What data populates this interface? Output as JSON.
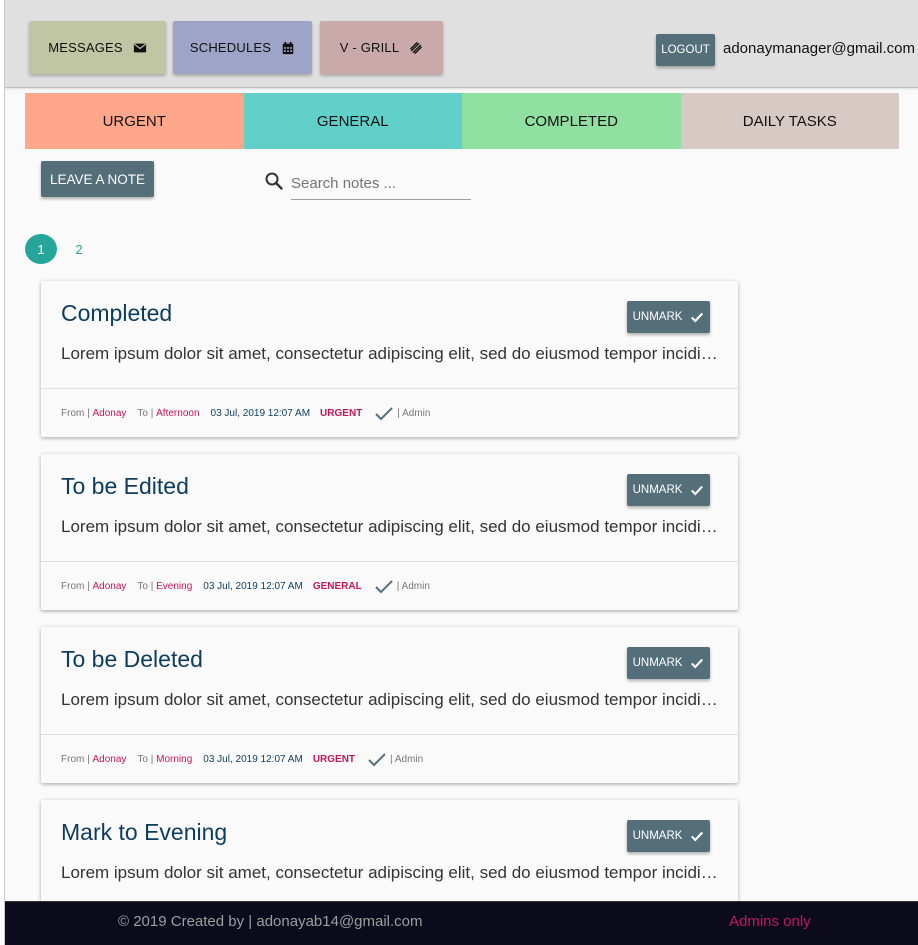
{
  "header": {
    "nav": [
      {
        "label": "MESSAGES",
        "icon": "envelope-icon",
        "color": "#c0c5a3"
      },
      {
        "label": "SCHEDULES",
        "icon": "calendar-icon",
        "color": "#9ea4c7"
      },
      {
        "label": "V - GRILL",
        "icon": "link-icon",
        "color": "#c9a9a9"
      }
    ],
    "logout_label": "LOGOUT",
    "user_email": "adonaymanager@gmail.com"
  },
  "tabs": [
    {
      "label": "URGENT",
      "color": "#ffa78a"
    },
    {
      "label": "GENERAL",
      "color": "#61d0c8"
    },
    {
      "label": "COMPLETED",
      "color": "#90e0a2"
    },
    {
      "label": "DAILY TASKS",
      "color": "#d7cac5"
    }
  ],
  "toolbar": {
    "leave_note_label": "LEAVE A NOTE",
    "search_placeholder": "Search notes ..."
  },
  "pagination": {
    "pages": [
      "1",
      "2"
    ],
    "current": "1"
  },
  "notes": [
    {
      "title": "Completed",
      "body": "Lorem ipsum dolor sit amet, consectetur adipiscing elit, sed do eiusmod tempor incididunt ut labore et dolore magna aliqua.",
      "button": "UNMARK",
      "from_label": "From |",
      "from": "Adonay",
      "to_label": "To |",
      "to": "Afternoon",
      "time": "03 Jul, 2019 12:07 AM",
      "category": "URGENT",
      "by": "| Admin"
    },
    {
      "title": "To be Edited",
      "body": "Lorem ipsum dolor sit amet, consectetur adipiscing elit, sed do eiusmod tempor incididunt ut labore et dolore magna aliqua.",
      "button": "UNMARK",
      "from_label": "From |",
      "from": "Adonay",
      "to_label": "To |",
      "to": "Evening",
      "time": "03 Jul, 2019 12:07 AM",
      "category": "GENERAL",
      "by": "| Admin"
    },
    {
      "title": "To be Deleted",
      "body": "Lorem ipsum dolor sit amet, consectetur adipiscing elit, sed do eiusmod tempor incididunt ut labore et dolore magna aliqua.",
      "button": "UNMARK",
      "from_label": "From |",
      "from": "Adonay",
      "to_label": "To |",
      "to": "Morning",
      "time": "03 Jul, 2019 12:07 AM",
      "category": "URGENT",
      "by": "| Admin"
    },
    {
      "title": "Mark to Evening",
      "body": "Lorem ipsum dolor sit amet, consectetur adipiscing elit, sed do eiusmod tempor incididunt ut labore et dolore magna aliqua.",
      "button": "UNMARK"
    }
  ],
  "footer": {
    "copyright": "© 2019 Created by | adonayab14@gmail.com",
    "admins_only": "Admins only"
  }
}
